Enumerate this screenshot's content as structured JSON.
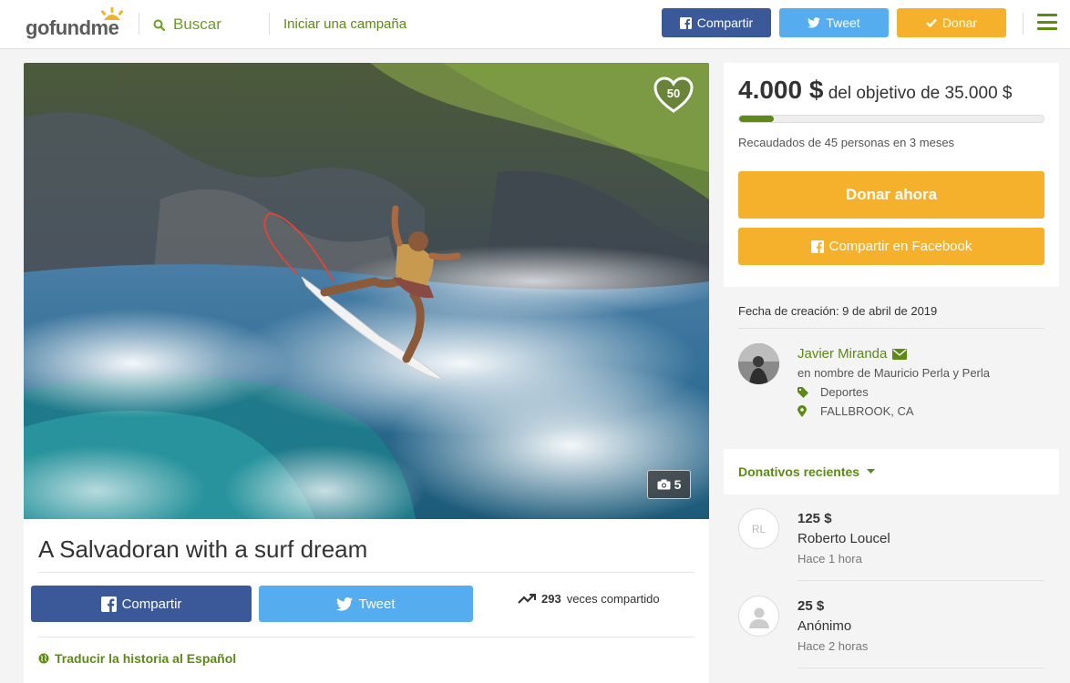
{
  "header": {
    "logo": {
      "part1": "go",
      "part2": "fund",
      "part3": "me"
    },
    "search_label": "Buscar",
    "start_campaign": "Iniciar una campaña",
    "share_button": "Compartir",
    "tweet_button": "Tweet",
    "donate_button": "Donar"
  },
  "hero": {
    "heart_count": "50",
    "photo_count": "5"
  },
  "campaign": {
    "title": "A Salvadoran with a surf dream",
    "share_button": "Compartir",
    "tweet_button": "Tweet",
    "shares_count": "293",
    "shares_label": "veces compartido",
    "translate_link": "Traducir la historia al Español"
  },
  "donation": {
    "raised": "4.000 $",
    "goal_text": "del objetivo de 35.000 $",
    "progress_fraction": 0.114,
    "raised_sub": "Recaudados de 45 personas en 3 meses",
    "donate_now": "Donar ahora",
    "share_facebook": "Compartir en Facebook"
  },
  "organizer": {
    "created": "Fecha de creación: 9 de abril de 2019",
    "name": "Javier Miranda",
    "on_behalf": "en nombre de Mauricio Perla y Perla",
    "category": "Deportes",
    "location": "FALLBROOK, CA"
  },
  "recent": {
    "title": "Donativos recientes",
    "donations": [
      {
        "initials": "RL",
        "amount": "125 $",
        "name": "Roberto Loucel",
        "time": "Hace 1 hora"
      },
      {
        "initials": "",
        "amount": "25 $",
        "name": "Anónimo",
        "time": "Hace 2 horas"
      }
    ]
  },
  "colors": {
    "brand_green": "#5c8a14",
    "facebook": "#3b5998",
    "twitter": "#55acee",
    "donate": "#f6b12c"
  }
}
